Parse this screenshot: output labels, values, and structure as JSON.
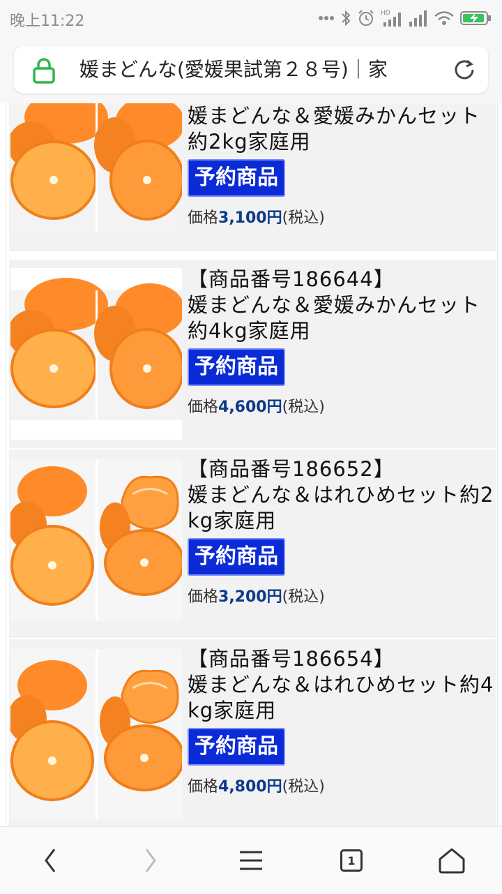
{
  "status_bar": {
    "time": "晚上11:22",
    "icons": [
      "more-dots-icon",
      "bluetooth-icon",
      "alarm-icon",
      "hd-signal-icon",
      "signal-icon",
      "wifi-icon",
      "battery-charging-icon"
    ]
  },
  "address_bar": {
    "url_text": "媛まどんな(愛媛果試第２８号)｜家",
    "lock_icon": "lock-icon",
    "reload_icon": "reload-icon",
    "lock_color": "#2db84d"
  },
  "products": [
    {
      "id_label": "",
      "name": "媛まどんな＆愛媛みかんセット約2kg家庭用",
      "badge": "予約商品",
      "price_label": "価格",
      "price_value": "3,100円",
      "tax": "(税込)",
      "image": "orange-halves-image"
    },
    {
      "id_label": "【商品番号186644】",
      "name": "媛まどんな＆愛媛みかんセット約4kg家庭用",
      "badge": "予約商品",
      "price_label": "価格",
      "price_value": "4,600円",
      "tax": "(税込)",
      "image": "orange-halves-image"
    },
    {
      "id_label": "【商品番号186652】",
      "name": "媛まどんな＆はれひめセット約2kg家庭用",
      "badge": "予約商品",
      "price_label": "価格",
      "price_value": "3,200円",
      "tax": "(税込)",
      "image": "orange-peeled-image"
    },
    {
      "id_label": "【商品番号186654】",
      "name": "媛まどんな＆はれひめセット約4kg家庭用",
      "badge": "予約商品",
      "price_label": "価格",
      "price_value": "4,800円",
      "tax": "(税込)",
      "image": "orange-peeled-image"
    }
  ],
  "bottom_nav": {
    "back_icon": "back-chevron-icon",
    "forward_icon": "forward-chevron-icon",
    "menu_icon": "menu-icon",
    "tabs_icon": "tabs-icon",
    "tab_count": "1",
    "home_icon": "home-icon"
  },
  "colors": {
    "badge_bg": "#0b2bd6",
    "price_color": "#0b3a8a",
    "row_bg": "#f2f2f2"
  }
}
